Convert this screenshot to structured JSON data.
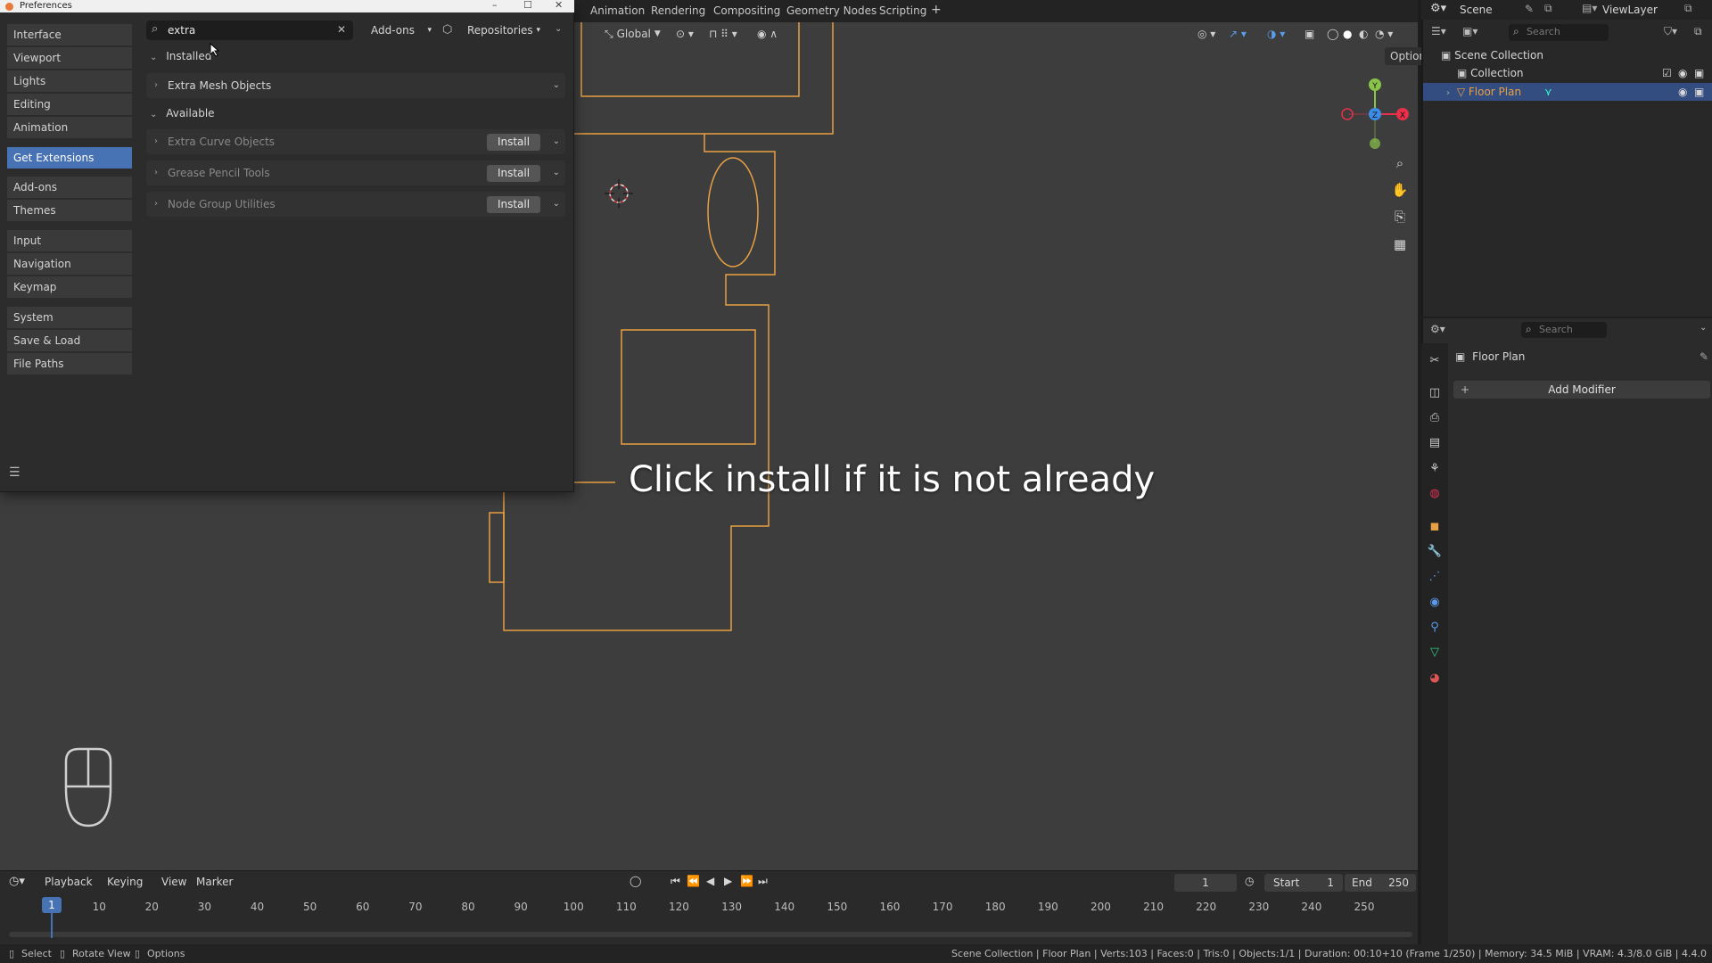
{
  "workspace_tabs": [
    "Animation",
    "Rendering",
    "Compositing",
    "Geometry Nodes",
    "Scripting",
    "+"
  ],
  "viewport": {
    "orientation": "Global",
    "options_label": "Options",
    "gizmo_axes": [
      "Y",
      "Z",
      "X"
    ],
    "colors": {
      "background": "#3d3d3d",
      "object_outline": "#e8a044",
      "axis_x": "#e8304a",
      "axis_y": "#8ac34a",
      "axis_z": "#3b8ee8"
    }
  },
  "preferences": {
    "window_title": "Preferences",
    "sidebar": [
      {
        "group": 1,
        "items": [
          "Interface",
          "Viewport",
          "Lights",
          "Editing",
          "Animation"
        ]
      },
      {
        "group": 2,
        "items": [
          "Get Extensions"
        ],
        "active": "Get Extensions"
      },
      {
        "group": 3,
        "items": [
          "Add-ons",
          "Themes"
        ]
      },
      {
        "group": 4,
        "items": [
          "Input",
          "Navigation",
          "Keymap"
        ]
      },
      {
        "group": 5,
        "items": [
          "System",
          "Save & Load",
          "File Paths"
        ]
      }
    ],
    "search": {
      "value": "extra"
    },
    "filter_dropdown": "Add-ons",
    "repositories_dropdown": "Repositories",
    "installed_header": "Installed",
    "installed_items": [
      "Extra Mesh Objects"
    ],
    "available_header": "Available",
    "available_items": [
      "Extra Curve Objects",
      "Grease Pencil Tools",
      "Node Group Utilities"
    ],
    "install_label": "Install"
  },
  "outliner": {
    "scene": "Scene",
    "view_layer": "ViewLayer",
    "search_placeholder": "Search",
    "rows": [
      "Scene Collection",
      "Collection",
      "Floor Plan"
    ]
  },
  "properties": {
    "search_placeholder": "Search",
    "object_name": "Floor Plan",
    "add_modifier": "Add Modifier"
  },
  "timeline": {
    "menus": [
      "Playback",
      "Keying",
      "View",
      "Marker"
    ],
    "current_frame": "1",
    "start_label": "Start",
    "start_value": "1",
    "end_label": "End",
    "end_value": "250",
    "ticks": [
      "1",
      "10",
      "20",
      "30",
      "40",
      "50",
      "60",
      "70",
      "80",
      "90",
      "100",
      "110",
      "120",
      "130",
      "140",
      "150",
      "160",
      "170",
      "180",
      "190",
      "200",
      "210",
      "220",
      "230",
      "240",
      "250"
    ]
  },
  "statusbar": {
    "left": [
      "Select",
      "Rotate View",
      "Options"
    ],
    "right": "Scene Collection | Floor Plan | Verts:103 | Faces:0 | Tris:0 | Objects:1/1 | Duration: 00:10+10 (Frame 1/250) | Memory: 34.5 MiB | VRAM: 4.3/8.0 GiB | 4.4.0"
  },
  "caption": "Click install if it is not already"
}
